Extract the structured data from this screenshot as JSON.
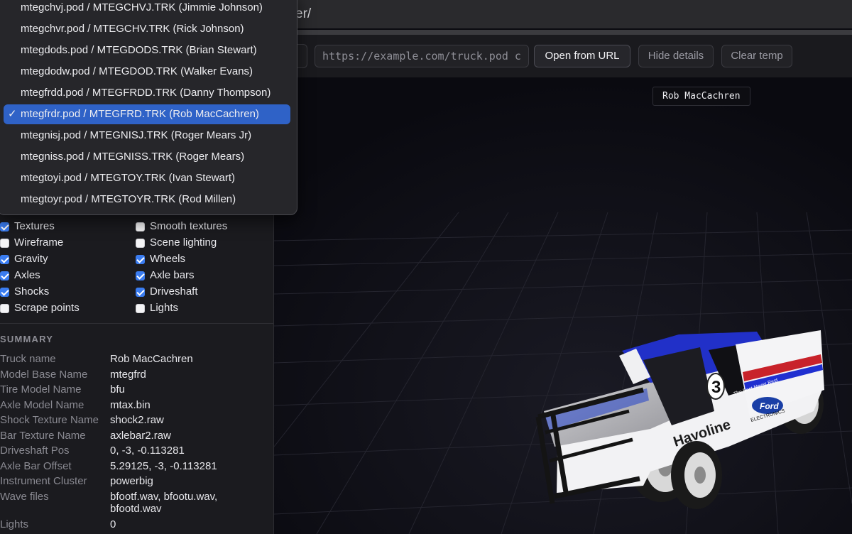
{
  "header": {
    "path_fragment": "er/"
  },
  "toolbar": {
    "url_placeholder": "https://example.com/truck.pod c",
    "open_url_label": "Open from URL",
    "hide_details_label": "Hide details",
    "clear_temp_label": "Clear temp"
  },
  "viewport": {
    "truck_label": "Rob MacCachren"
  },
  "dropdown": {
    "items": [
      {
        "label": "mtegchvj.pod / MTEGCHVJ.TRK (Jimmie Johnson)",
        "selected": false
      },
      {
        "label": "mtegchvr.pod / MTEGCHV.TRK (Rick Johnson)",
        "selected": false
      },
      {
        "label": "mtegdods.pod / MTEGDODS.TRK (Brian Stewart)",
        "selected": false
      },
      {
        "label": "mtegdodw.pod / MTEGDOD.TRK (Walker Evans)",
        "selected": false
      },
      {
        "label": "mtegfrdd.pod / MTEGFRDD.TRK (Danny Thompson)",
        "selected": false
      },
      {
        "label": "mtegfrdr.pod / MTEGFRD.TRK (Rob MacCachren)",
        "selected": true
      },
      {
        "label": "mtegnisj.pod / MTEGNISJ.TRK (Roger Mears Jr)",
        "selected": false
      },
      {
        "label": "mtegniss.pod / MTEGNISS.TRK (Roger Mears)",
        "selected": false
      },
      {
        "label": "mtegtoyi.pod / MTEGTOY.TRK (Ivan Stewart)",
        "selected": false
      },
      {
        "label": "mtegtoyr.pod / MTEGTOYR.TRK (Rod Millen)",
        "selected": false
      }
    ],
    "check_glyph": "✓"
  },
  "options": [
    {
      "label": "Textures",
      "checked": true
    },
    {
      "label": "Smooth textures",
      "checked": false
    },
    {
      "label": "Wireframe",
      "checked": false
    },
    {
      "label": "Scene lighting",
      "checked": false
    },
    {
      "label": "Gravity",
      "checked": true
    },
    {
      "label": "Wheels",
      "checked": true
    },
    {
      "label": "Axles",
      "checked": true
    },
    {
      "label": "Axle bars",
      "checked": true
    },
    {
      "label": "Shocks",
      "checked": true
    },
    {
      "label": "Driveshaft",
      "checked": true
    },
    {
      "label": "Scrape points",
      "checked": false
    },
    {
      "label": "Lights",
      "checked": false
    }
  ],
  "summary": {
    "title": "SUMMARY",
    "rows": [
      {
        "key": "Truck name",
        "value": "Rob MacCachren"
      },
      {
        "key": "Model Base Name",
        "value": "mtegfrd"
      },
      {
        "key": "Tire Model Name",
        "value": "bfu"
      },
      {
        "key": "Axle Model Name",
        "value": "mtax.bin"
      },
      {
        "key": "Shock Texture Name",
        "value": "shock2.raw"
      },
      {
        "key": "Bar Texture Name",
        "value": "axlebar2.raw"
      },
      {
        "key": "Driveshaft Pos",
        "value": "0, -3, -0.113281"
      },
      {
        "key": "Axle Bar Offset",
        "value": "5.29125, -3, -0.113281"
      },
      {
        "key": "Instrument Cluster",
        "value": "powerbig"
      },
      {
        "key": "Wave files",
        "value": "bfootf.wav, bfootu.wav, bfootd.wav"
      },
      {
        "key": "Lights",
        "value": "0"
      }
    ]
  },
  "truck_decals": {
    "number": "3",
    "sponsor": "Havoline",
    "brand": "Ford",
    "brand_sub": "ELECTRONICS",
    "slogan": "The Best Never Rest"
  },
  "colors": {
    "accent": "#3a7cf0",
    "menu_selection": "#2f62c7",
    "truck_blue": "#1f2fd0",
    "truck_red": "#c8222a"
  }
}
